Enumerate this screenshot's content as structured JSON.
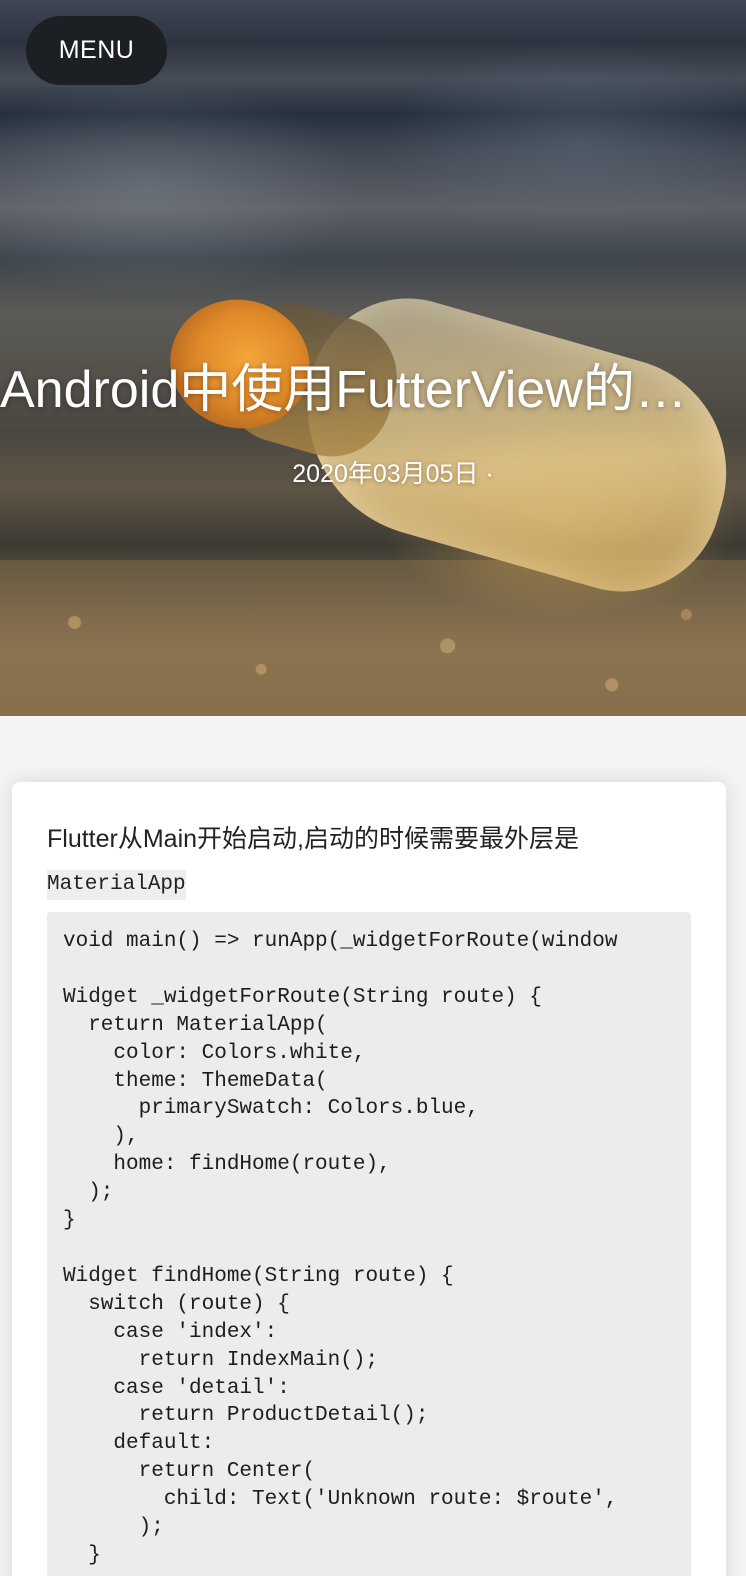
{
  "header": {
    "menu_label": "MENU"
  },
  "post": {
    "title": "Android中使用FutterView的…",
    "date": "2020年03月05日 ·"
  },
  "article": {
    "intro_text": "Flutter从Main开始启动,启动的时候需要最外层是",
    "intro_code": "MaterialApp",
    "code_lines": [
      "void main() => runApp(_widgetForRoute(window",
      "",
      "Widget _widgetForRoute(String route) {",
      "  return MaterialApp(",
      "    color: Colors.white,",
      "    theme: ThemeData(",
      "      primarySwatch: Colors.blue,",
      "    ),",
      "    home: findHome(route),",
      "  );",
      "}",
      "",
      "Widget findHome(String route) {",
      "  switch (route) {",
      "    case 'index':",
      "      return IndexMain();",
      "    case 'detail':",
      "      return ProductDetail();",
      "    default:",
      "      return Center(",
      "        child: Text('Unknown route: $route',",
      "      );",
      "  }"
    ]
  },
  "colors": {
    "menu_bg": "#1c1f24",
    "code_bg": "#ececec",
    "page_bg": "#f4f4f4"
  }
}
